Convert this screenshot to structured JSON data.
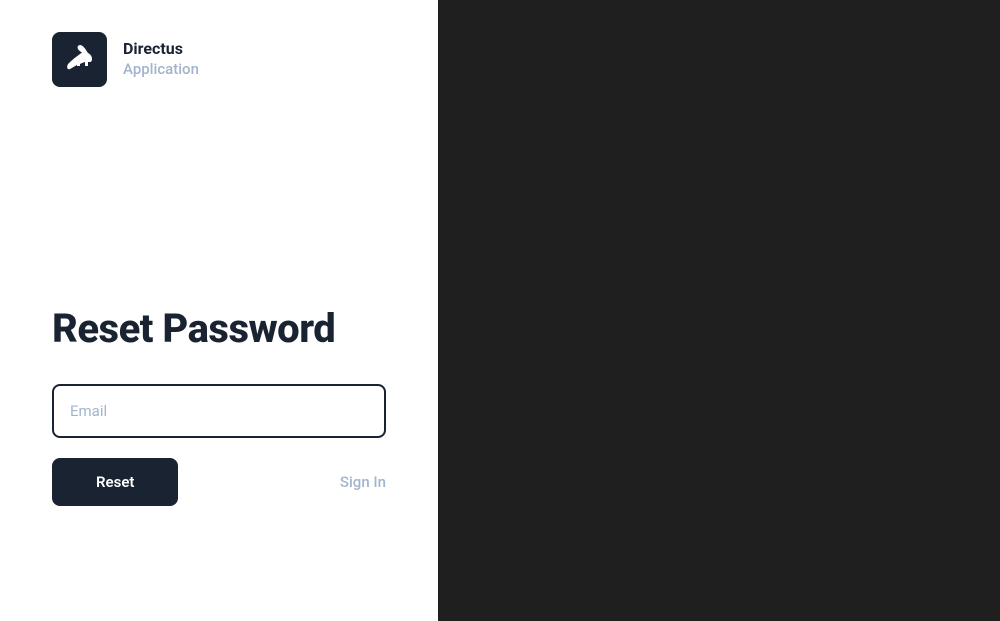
{
  "project": {
    "name": "Directus",
    "subtitle": "Application"
  },
  "page": {
    "title": "Reset Password"
  },
  "form": {
    "email_placeholder": "Email",
    "email_value": "",
    "reset_button_label": "Reset",
    "sign_in_link_label": "Sign In"
  }
}
